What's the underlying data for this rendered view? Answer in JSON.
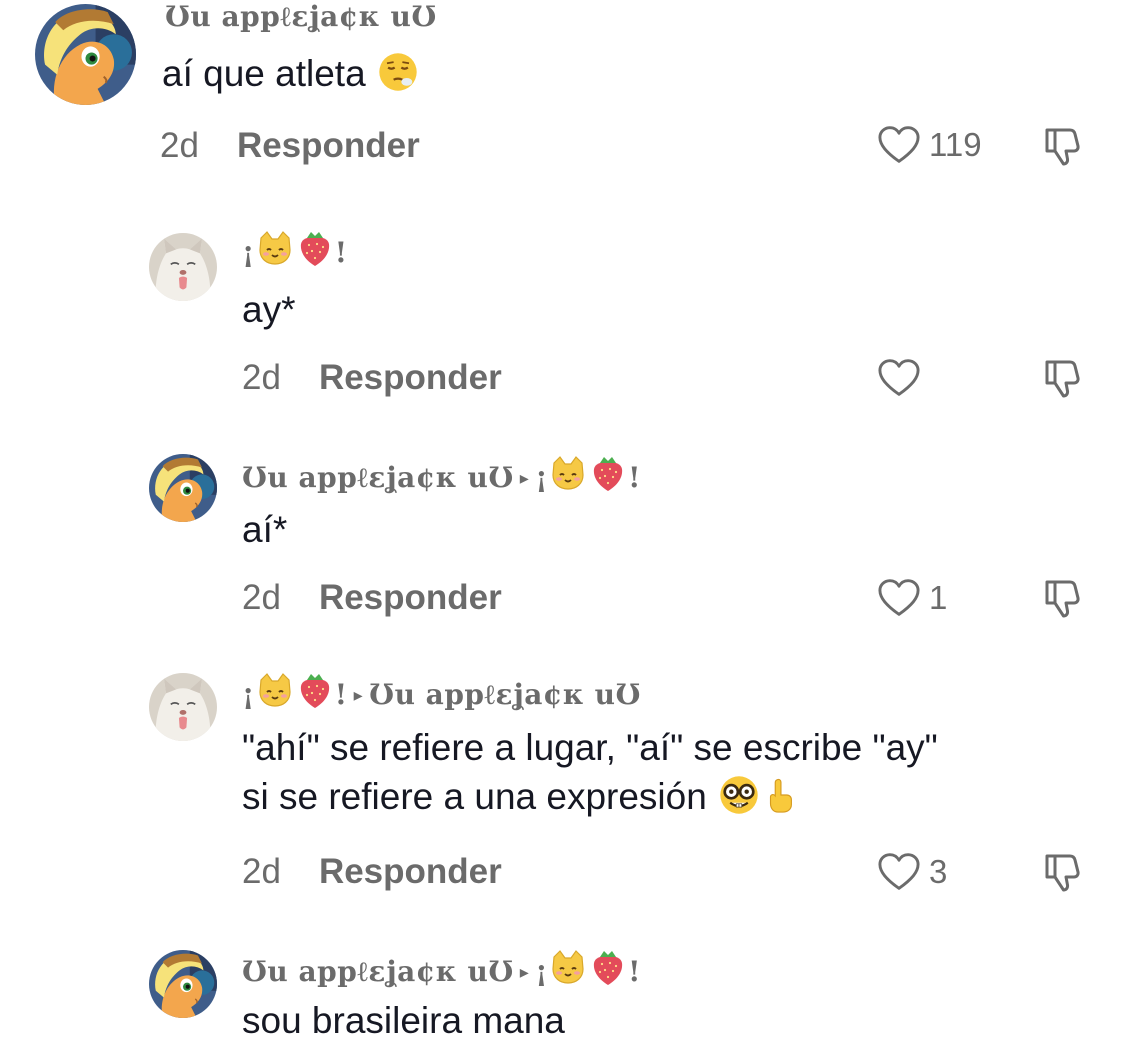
{
  "comments": [
    {
      "username": "Ʊu appℓεʝa¢κ uƱ",
      "text": "aí que atleta",
      "text_emoji": "relieved-face-emoji",
      "time": "2d",
      "reply_label": "Responder",
      "likes": "119"
    },
    {
      "username_prefix": "¡",
      "username_suffix": "!",
      "username_emojis": [
        "cat-face-emoji",
        "strawberry-emoji"
      ],
      "text": "ay*",
      "time": "2d",
      "reply_label": "Responder",
      "likes": ""
    },
    {
      "username": "Ʊu appℓεʝa¢κ uƱ",
      "reply_to_prefix": "¡",
      "reply_to_suffix": "!",
      "reply_to_emojis": [
        "cat-face-emoji",
        "strawberry-emoji"
      ],
      "text": "aí*",
      "time": "2d",
      "reply_label": "Responder",
      "likes": "1"
    },
    {
      "username_prefix": "¡",
      "username_suffix": "!",
      "username_emojis": [
        "cat-face-emoji",
        "strawberry-emoji"
      ],
      "reply_to": "Ʊu appℓεʝa¢κ uƱ",
      "text_line1": "\"ahí\" se refiere a lugar, \"aí\" se escribe \"ay\"",
      "text_line2": "si se refiere a una expresión",
      "text_emojis": [
        "nerd-face-emoji",
        "pointing-up-emoji"
      ],
      "time": "2d",
      "reply_label": "Responder",
      "likes": "3"
    },
    {
      "username": "Ʊu appℓεʝa¢κ uƱ",
      "reply_to_prefix": "¡",
      "reply_to_suffix": "!",
      "reply_to_emojis": [
        "cat-face-emoji",
        "strawberry-emoji"
      ],
      "text": "sou brasileira mana"
    }
  ],
  "icons": {
    "like": "heart-outline-icon",
    "dislike": "thumbs-down-outline-icon",
    "reply_arrow": "▸"
  },
  "colors": {
    "text": "#161823",
    "muted": "#6b6b6b",
    "background": "#ffffff"
  }
}
